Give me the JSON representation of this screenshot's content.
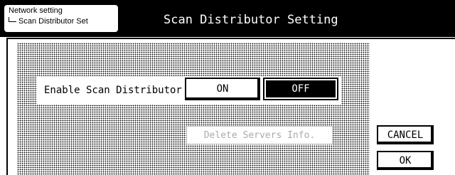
{
  "breadcrumb": {
    "parent": "Network setting",
    "current": "Scan Distributor Set"
  },
  "title": "Scan Distributor Setting",
  "setting": {
    "label": "Enable Scan Distributor",
    "options": [
      "ON",
      "OFF"
    ],
    "selected": "OFF"
  },
  "actions": {
    "delete_label": "Delete Servers Info.",
    "delete_enabled": false,
    "cancel_label": "CANCEL",
    "ok_label": "OK"
  },
  "colors": {
    "title_bar": "#000000",
    "selected_button": "#000000",
    "disabled_text": "#aaaaaa"
  }
}
